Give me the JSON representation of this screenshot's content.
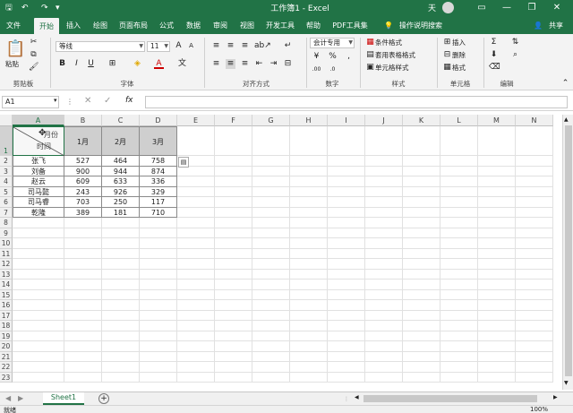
{
  "titlebar": {
    "title": "工作簿1 - Excel",
    "user_initial": "天",
    "minimize": "—",
    "restore": "❐",
    "close": "✕"
  },
  "tabs": [
    {
      "label": "文件"
    },
    {
      "label": "开始"
    },
    {
      "label": "插入"
    },
    {
      "label": "绘图"
    },
    {
      "label": "页面布局"
    },
    {
      "label": "公式"
    },
    {
      "label": "数据"
    },
    {
      "label": "审阅"
    },
    {
      "label": "视图"
    },
    {
      "label": "开发工具"
    },
    {
      "label": "帮助"
    },
    {
      "label": "PDF工具集"
    }
  ],
  "active_tab": "开始",
  "tell_me": "操作说明搜索",
  "share": "共享",
  "ribbon": {
    "paste": "粘贴",
    "font_name": "等线",
    "font_size": "11",
    "number_format": "会计专用",
    "conditional_format": "条件格式",
    "table_format": "套用表格格式",
    "cell_styles": "单元格样式",
    "insert": "插入",
    "delete": "删除",
    "format": "格式",
    "groups": {
      "clipboard": "剪贴板",
      "font": "字体",
      "alignment": "对齐方式",
      "number": "数字",
      "styles": "样式",
      "cells": "单元格",
      "editing": "编辑"
    }
  },
  "formula_bar": {
    "name_box": "A1",
    "fx": "fx"
  },
  "columns": [
    "A",
    "B",
    "C",
    "D",
    "E",
    "F",
    "G",
    "H",
    "I",
    "J",
    "K",
    "L",
    "M",
    "N"
  ],
  "rows": [
    "1",
    "2",
    "3",
    "4",
    "5",
    "6",
    "7",
    "8",
    "9",
    "10",
    "11",
    "12",
    "13",
    "14",
    "15",
    "16",
    "17",
    "18",
    "19",
    "20",
    "21",
    "22",
    "23"
  ],
  "table": {
    "corner_top": "月份",
    "corner_bottom": "时间",
    "headers": [
      "1月",
      "2月",
      "3月"
    ],
    "data": [
      {
        "name": "张飞",
        "values": [
          "527",
          "464",
          "758"
        ]
      },
      {
        "name": "刘备",
        "values": [
          "900",
          "944",
          "874"
        ]
      },
      {
        "name": "赵云",
        "values": [
          "609",
          "633",
          "336"
        ]
      },
      {
        "name": "司马懿",
        "values": [
          "243",
          "926",
          "329"
        ]
      },
      {
        "name": "司马睿",
        "values": [
          "703",
          "250",
          "117"
        ]
      },
      {
        "name": "乾隆",
        "values": [
          "389",
          "181",
          "710"
        ]
      }
    ]
  },
  "sheet_tab": "Sheet1",
  "status": {
    "ready": "就绪",
    "zoom": "100%"
  }
}
